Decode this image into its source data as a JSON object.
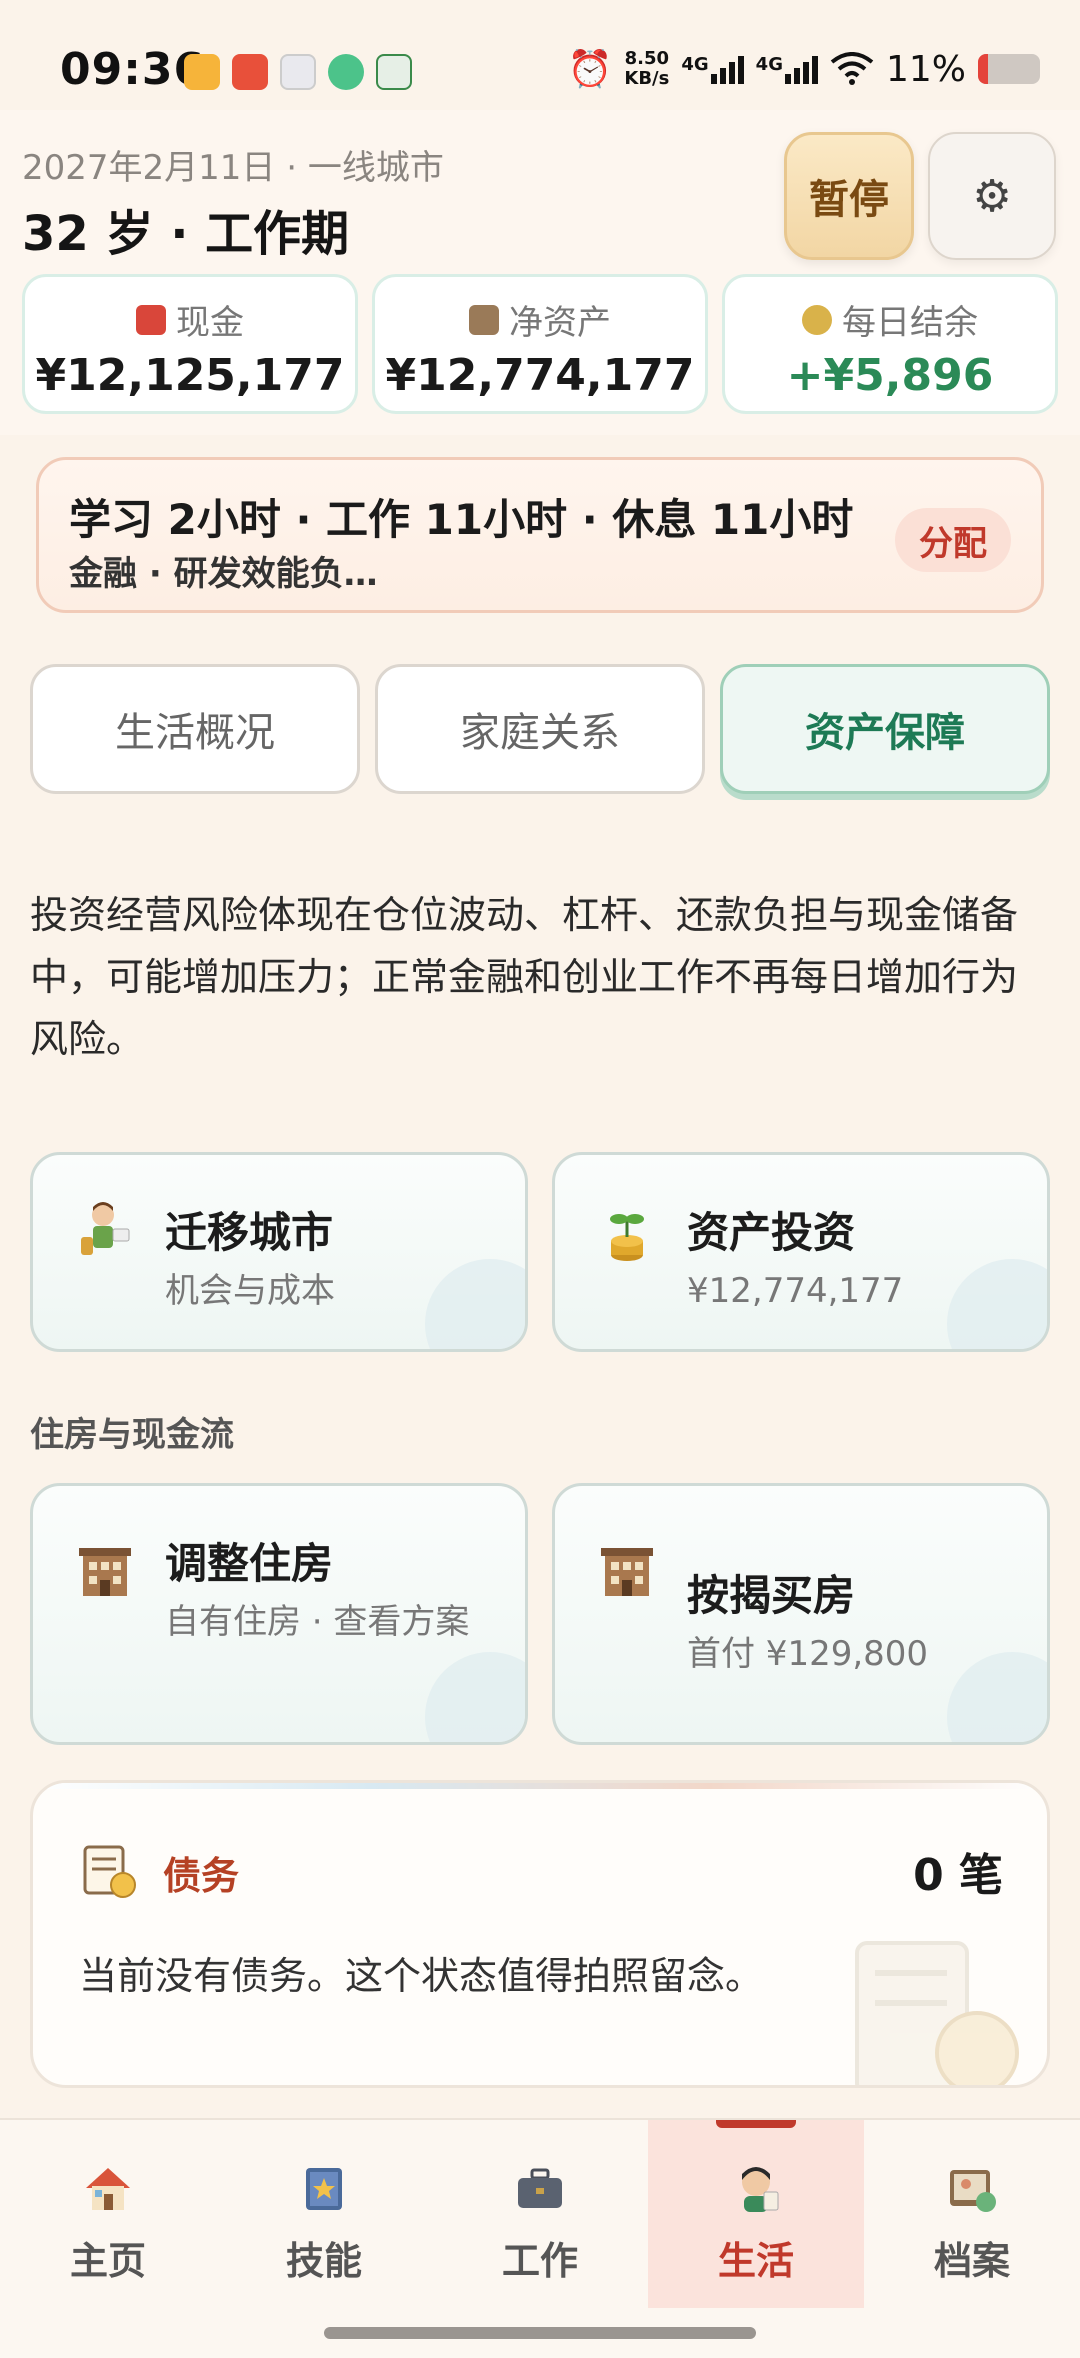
{
  "status_bar": {
    "time": "09:36",
    "net_speed_value": "8.50",
    "net_speed_unit": "KB/s",
    "signal_1": "4G",
    "signal_2": "4G",
    "battery": "11%"
  },
  "header": {
    "date_line": "2027年2月11日 · 一线城市",
    "age_line": "32 岁 · 工作期",
    "pause_label": "暂停",
    "settings_icon": "gear-icon"
  },
  "stats": [
    {
      "label": "现金",
      "value": "¥12,125,177",
      "icon": "red-envelope-icon",
      "color": "#c0392b"
    },
    {
      "label": "净资产",
      "value": "¥12,774,177",
      "icon": "building-icon",
      "color": "#8a6b4a"
    },
    {
      "label": "每日结余",
      "value": "+¥5,896",
      "icon": "sprout-coin-icon",
      "color": "#2b8a57"
    }
  ],
  "schedule": {
    "main": "学习 2小时 · 工作 11小时 · 休息 11小时",
    "sub": "金融 · 研发效能负…",
    "allocate_label": "分配"
  },
  "tabs": [
    {
      "label": "生活概况",
      "active": false
    },
    {
      "label": "家庭关系",
      "active": false
    },
    {
      "label": "资产保障",
      "active": true
    }
  ],
  "description": "投资经营风险体现在仓位波动、杠杆、还款负担与现金储备中，可能增加压力；正常金融和创业工作不再每日增加行为风险。",
  "action_cards": {
    "relocate": {
      "title": "迁移城市",
      "subtitle": "机会与成本"
    },
    "invest": {
      "title": "资产投资",
      "subtitle": "¥12,774,177"
    }
  },
  "housing_section": {
    "label": "住房与现金流",
    "adjust": {
      "title": "调整住房",
      "subtitle": "自有住房 · 查看方案"
    },
    "mortgage": {
      "title": "按揭买房",
      "subtitle": "首付 ¥129,800"
    }
  },
  "debt": {
    "title": "债务",
    "count": "0 笔",
    "text": "当前没有债务。这个状态值得拍照留念。"
  },
  "bottom_nav": [
    {
      "label": "主页",
      "icon": "house-icon",
      "active": false
    },
    {
      "label": "技能",
      "icon": "skill-book-icon",
      "active": false
    },
    {
      "label": "工作",
      "icon": "briefcase-icon",
      "active": false
    },
    {
      "label": "生活",
      "icon": "person-life-icon",
      "active": true
    },
    {
      "label": "档案",
      "icon": "profile-archive-icon",
      "active": false
    }
  ]
}
